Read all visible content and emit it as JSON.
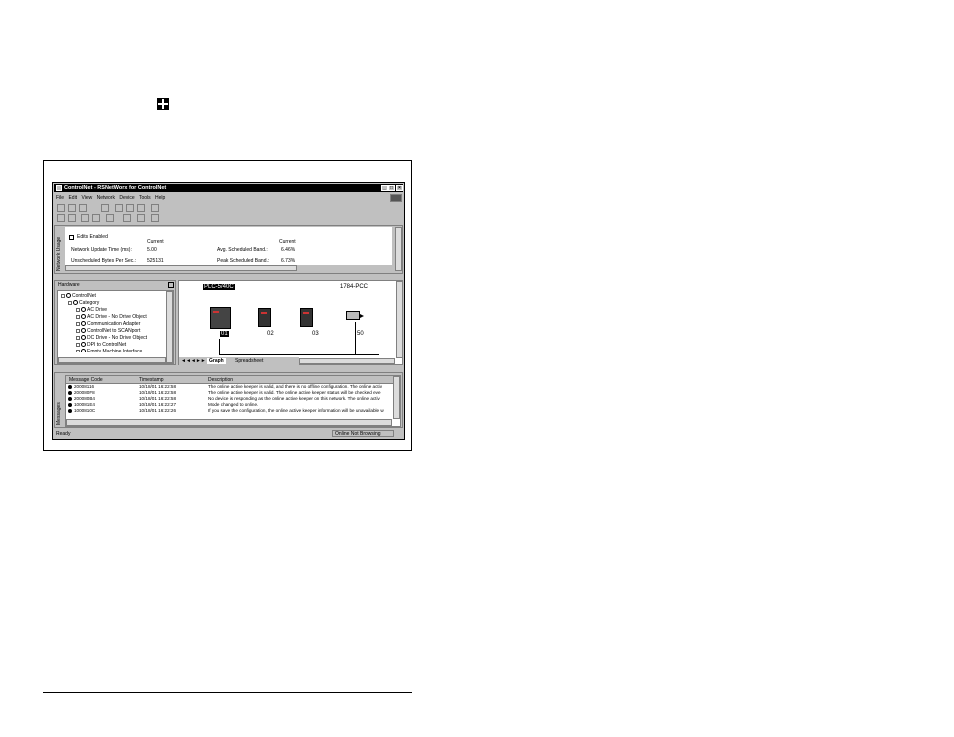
{
  "window": {
    "title": "ControlNet - RSNetWorx for ControlNet",
    "minimize": "_",
    "maximize": "□",
    "close": "×"
  },
  "menu": [
    "File",
    "Edit",
    "View",
    "Network",
    "Device",
    "Tools",
    "Help"
  ],
  "network_usage": {
    "panel_label": "Network Usage",
    "edits_enabled": "Edits Enabled",
    "col_current_left": "Current",
    "col_current_right": "Current",
    "rows": [
      {
        "label": "Network Update Time (ms):",
        "value": "5.00",
        "label2": "Avg. Scheduled Band.:",
        "value2": "6.46%"
      },
      {
        "label": "Unscheduled Bytes Per Sec.:",
        "value": "525131",
        "label2": "Peak Scheduled Band.:",
        "value2": "6.73%"
      }
    ]
  },
  "hardware": {
    "title": "Hardware",
    "items": [
      {
        "text": "ControlNet",
        "level": 0
      },
      {
        "text": "Category",
        "level": 1
      },
      {
        "text": "AC Drive",
        "level": 2
      },
      {
        "text": "AC Drive - No Drive Object",
        "level": 2
      },
      {
        "text": "Communication Adapter",
        "level": 2
      },
      {
        "text": "ControlNet to SCANport",
        "level": 2
      },
      {
        "text": "DC Drive - No Drive Object",
        "level": 2
      },
      {
        "text": "DPI to ControlNet",
        "level": 2
      },
      {
        "text": "Empty Machine Interface",
        "level": 2
      }
    ]
  },
  "graph": {
    "device_left_label": "PLC-5/40C",
    "device_right_label": "1784-PCC",
    "nodes": [
      "01",
      "02",
      "03",
      "50"
    ],
    "tabs": {
      "graph": "Graph",
      "spreadsheet": "Spreadsheet"
    }
  },
  "messages": {
    "panel_label": "Messages",
    "headers": {
      "code": "Message Code",
      "time": "Timestamp",
      "desc": "Description"
    },
    "rows": [
      {
        "code": "20008116",
        "time": "10/18/01 16:22:58",
        "desc": "The online active keeper is valid, and there is no offline configuration. The online activ"
      },
      {
        "code": "200080F8",
        "time": "10/18/01 16:22:58",
        "desc": "The online active keeper is valid. The online active keeper status will be checked eve"
      },
      {
        "code": "200080B4",
        "time": "10/18/01 16:22:58",
        "desc": "No device is responding as the online active keeper on this network. The online activ"
      },
      {
        "code": "100081E4",
        "time": "10/18/01 16:22:27",
        "desc": "Mode changed to online."
      },
      {
        "code": "1000810C",
        "time": "10/18/01 16:22:26",
        "desc": "If you save the configuration, the online active keeper information will be unavailable w"
      }
    ]
  },
  "status": {
    "left": "Ready",
    "right": "Online Not Browsing"
  }
}
